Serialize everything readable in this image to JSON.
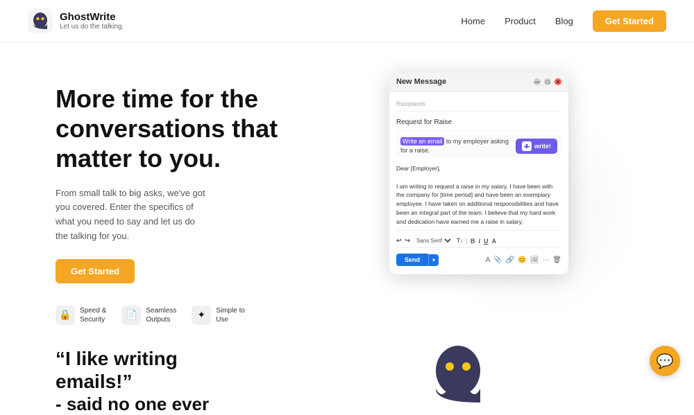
{
  "nav": {
    "logo_title": "GhostWrite",
    "logo_subtitle": "Let us do the talking.",
    "links": [
      "Home",
      "Product",
      "Blog"
    ],
    "cta": "Get Started"
  },
  "hero": {
    "heading": "More time for the\nconversations that\nmatter to you.",
    "description": "From small talk to big asks, we've got you covered. Enter the specifics of what you need to say and let us do the talking for you.",
    "cta": "Get Started",
    "features": [
      {
        "icon": "🔒",
        "label": "Speed &\nSecurity"
      },
      {
        "icon": "📄",
        "label": "Seamless\nOutputs"
      },
      {
        "icon": "✦",
        "label": "Simple to\nUse"
      }
    ]
  },
  "email_window": {
    "title": "New Message",
    "recipients_label": "Recipients",
    "subject": "Request for Raise",
    "prompt_highlight": "Write an email",
    "prompt_rest": " to my employer asking for a raise.",
    "write_btn": "write!",
    "content": "Dear [Employer],\n\nI am writing to request a raise in my salary. I have been with the company for [time period] and have been an exemplary employee. I have taken on additional responsibilities and have been an integral part of the team. I believe that my hard work and dedication have earned me a raise in salary.\n\nThank you for your time and consideration. I look forward to hearing from you soon.\n\nSincerely,",
    "font_select": "Sans Serif",
    "send_btn": "Send"
  },
  "lower": {
    "quote_line1": "“I like writing emails!”",
    "quote_line2": "- said no one ever"
  },
  "chat_btn": "💬"
}
